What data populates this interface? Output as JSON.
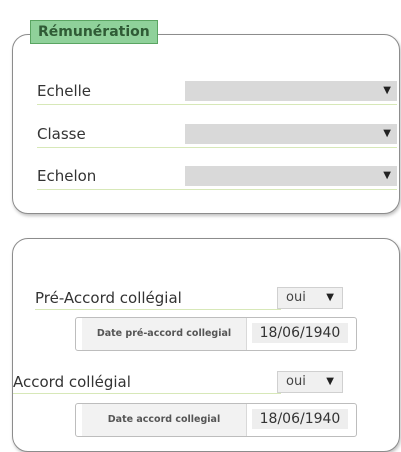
{
  "remuneration": {
    "legend": "Rémunération",
    "fields": [
      {
        "label": "Echelle",
        "arrow": "▼"
      },
      {
        "label": "Classe",
        "arrow": "▼"
      },
      {
        "label": "Echelon",
        "arrow": "▼"
      }
    ]
  },
  "accords": {
    "pre_accord": {
      "label": "Pré-Accord collégial",
      "select_value": "oui",
      "arrow": "▼",
      "date_label": "Date pré-accord collegial",
      "date_value": "18/06/1940"
    },
    "accord": {
      "label": "Accord collégial",
      "select_value": "oui",
      "arrow": "▼",
      "date_label": "Date accord collegial",
      "date_value": "18/06/1940"
    }
  }
}
